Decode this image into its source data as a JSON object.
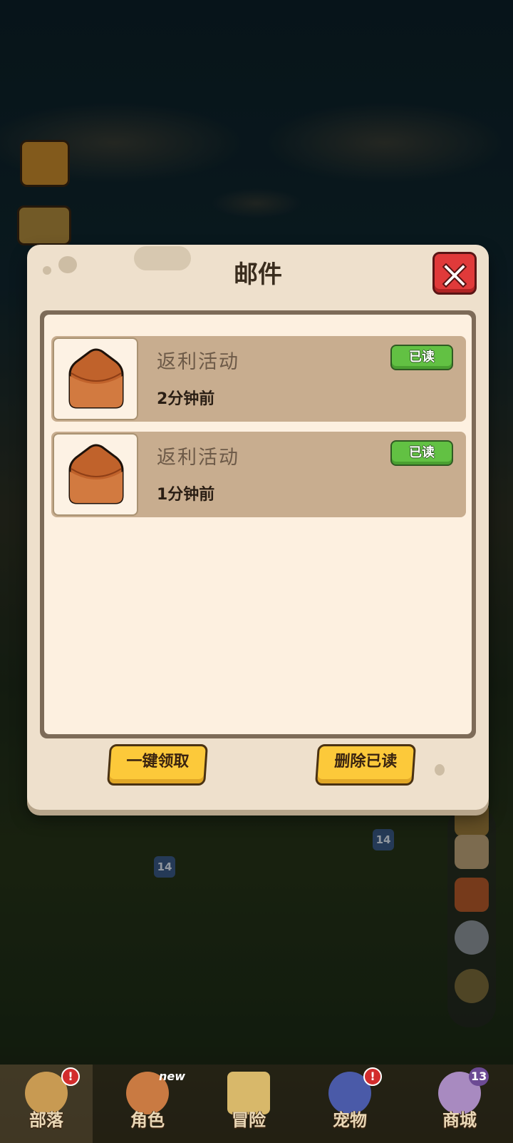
{
  "dialog": {
    "title": "邮件",
    "close_icon": "close-icon",
    "mails": [
      {
        "title": "返利活动",
        "time": "2分钟前",
        "status": "已读",
        "icon": "envelope-icon"
      },
      {
        "title": "返利活动",
        "time": "1分钟前",
        "status": "已读",
        "icon": "envelope-icon"
      }
    ],
    "claim_all_label": "一键领取",
    "delete_read_label": "删除已读"
  },
  "bottom_nav": {
    "items": [
      {
        "label": "部落",
        "badge": "!",
        "active": true
      },
      {
        "label": "角色",
        "badge": "new"
      },
      {
        "label": "冒险"
      },
      {
        "label": "宠物",
        "badge": "!"
      },
      {
        "label": "商城",
        "badge": "13"
      }
    ]
  },
  "map_badges": [
    "14",
    "14"
  ],
  "colors": {
    "read_badge": "#62c143",
    "close_button": "#e03a3a",
    "action_button": "#fcc93a",
    "dialog_bg": "#eee0cc"
  }
}
